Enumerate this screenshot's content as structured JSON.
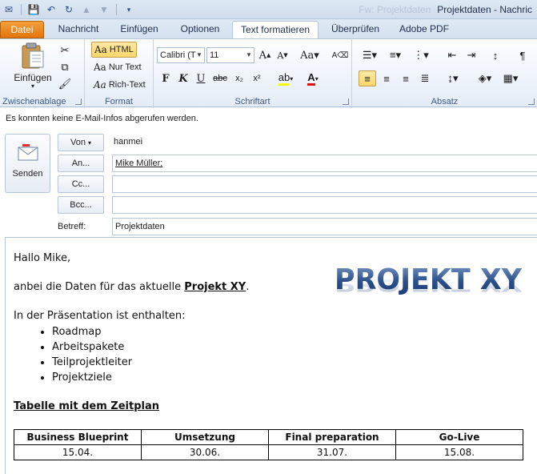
{
  "window": {
    "title": "Projektdaten - Nachric",
    "ghost_title": "Fw: Projektdaten"
  },
  "tabs": [
    {
      "label": "Datei"
    },
    {
      "label": "Nachricht"
    },
    {
      "label": "Einfügen"
    },
    {
      "label": "Optionen"
    },
    {
      "label": "Text formatieren"
    },
    {
      "label": "Überprüfen"
    },
    {
      "label": "Adobe PDF"
    }
  ],
  "ribbon": {
    "clipboard": {
      "label": "Zwischenablage",
      "paste": "Einfügen"
    },
    "format": {
      "label": "Format",
      "html": "HTML",
      "plain": "Nur Text",
      "rich": "Rich-Text"
    },
    "font": {
      "label": "Schriftart",
      "family": "Calibri (T",
      "size": "11"
    },
    "paragraph": {
      "label": "Absatz"
    }
  },
  "info": "Es konnten keine E-Mail-Infos abgerufen werden.",
  "header": {
    "send": "Senden",
    "from_btn": "Von",
    "from_value": "hanmei",
    "to_btn": "An...",
    "to_value": "Mike Müller;",
    "cc_btn": "Cc...",
    "bcc_btn": "Bcc...",
    "subject_label": "Betreff:",
    "subject_value": "Projektdaten"
  },
  "body": {
    "greeting": "Hallo Mike,",
    "intro_pre": "anbei die Daten für das aktuelle ",
    "intro_link": "Projekt XY",
    "intro_post": ".",
    "list_intro": "In der Präsentation ist enthalten:",
    "items": [
      "Roadmap",
      "Arbeitspakete",
      "Teilprojektleiter",
      "Projektziele"
    ],
    "table_title": "Tabelle mit dem Zeitplan",
    "table_headers": [
      "Business Blueprint",
      "Umsetzung",
      "Final preparation",
      "Go-Live"
    ],
    "table_values": [
      "15.04.",
      "30.06.",
      "31.07.",
      "15.08."
    ],
    "logo_text": "PROJEKT XY"
  }
}
